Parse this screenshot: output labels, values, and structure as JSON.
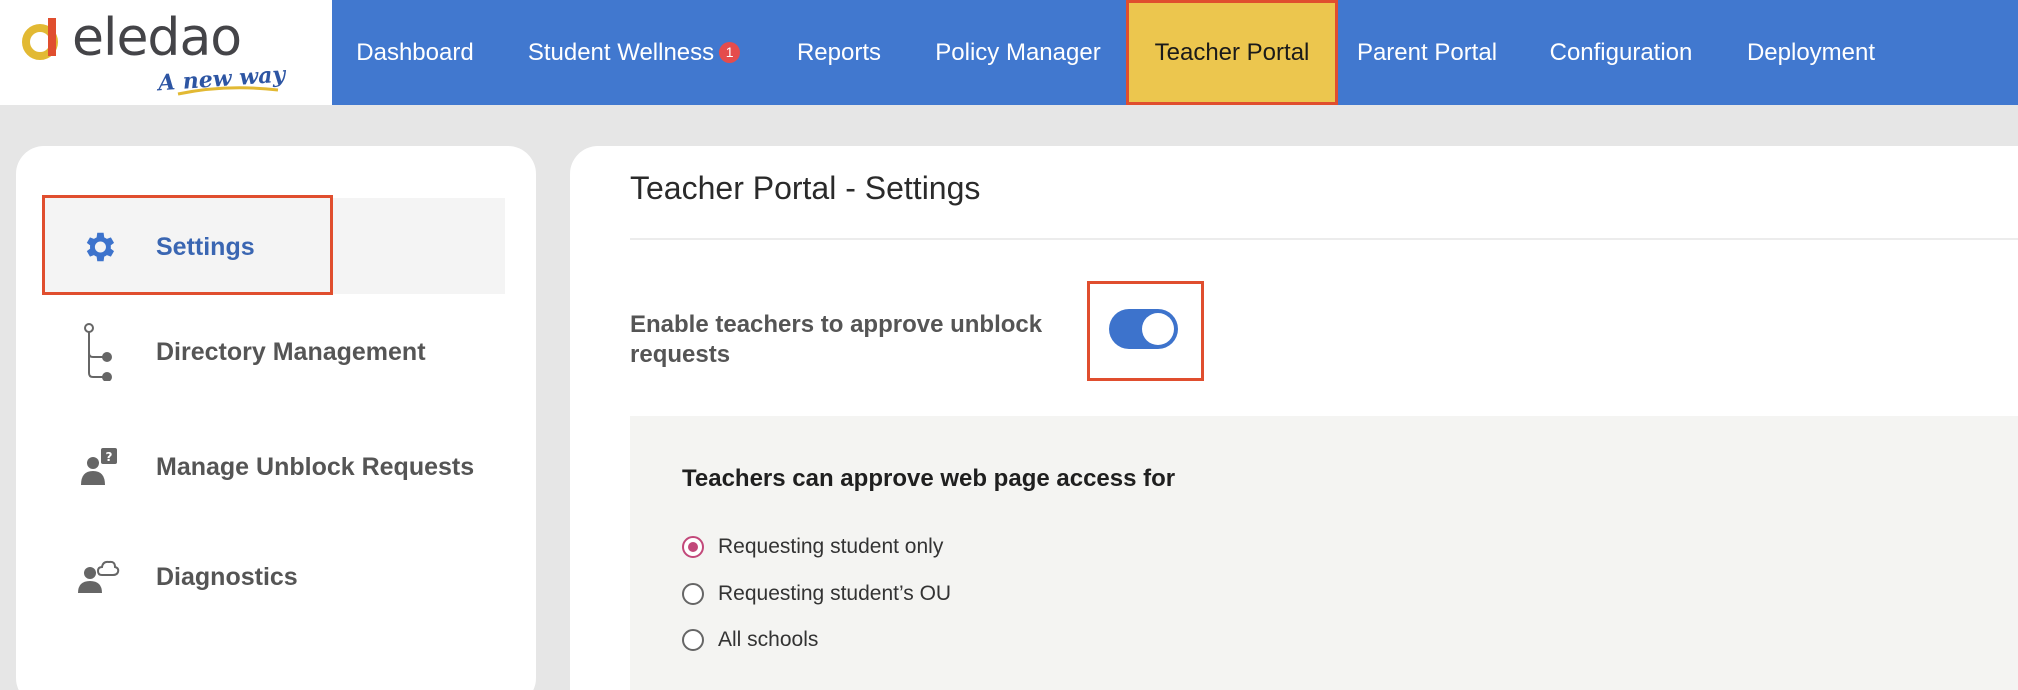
{
  "brand": {
    "name": "eledao",
    "tagline": "A new way",
    "colors": {
      "primary": "#4178cf",
      "accent": "#ecc64e",
      "highlight": "#e04e2e",
      "radio": "#c2487a"
    }
  },
  "nav": {
    "items": [
      {
        "label": "Dashboard"
      },
      {
        "label": "Student Wellness",
        "badge": "1"
      },
      {
        "label": "Reports"
      },
      {
        "label": "Policy Manager"
      },
      {
        "label": "Teacher Portal",
        "active": true
      },
      {
        "label": "Parent Portal"
      },
      {
        "label": "Configuration"
      },
      {
        "label": "Deployment"
      }
    ]
  },
  "sidebar": {
    "items": [
      {
        "label": "Settings",
        "icon": "gear-icon",
        "active": true
      },
      {
        "label": "Directory Management",
        "icon": "tree-icon"
      },
      {
        "label": "Manage Unblock Requests",
        "icon": "user-question-icon"
      },
      {
        "label": "Diagnostics",
        "icon": "user-cloud-icon"
      }
    ]
  },
  "main": {
    "title": "Teacher Portal - Settings",
    "toggle_option": {
      "label": "Enable teachers to approve unblock requests",
      "enabled": true
    },
    "access": {
      "title": "Teachers can approve web page access for",
      "options": [
        {
          "label": "Requesting student only",
          "selected": true
        },
        {
          "label": "Requesting student’s OU",
          "selected": false
        },
        {
          "label": "All schools",
          "selected": false
        }
      ]
    }
  }
}
